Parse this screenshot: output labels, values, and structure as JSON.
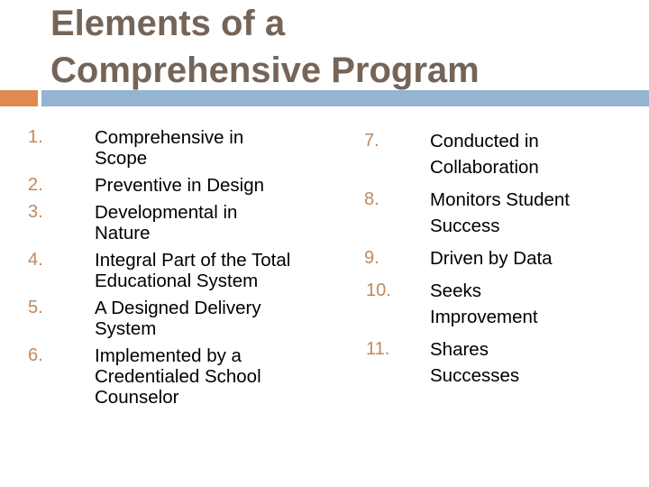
{
  "slide": {
    "title_lines": [
      "Elements of a",
      "Comprehensive Program"
    ],
    "colors": {
      "title": "#756458",
      "accent_orange": "#df8a4f",
      "accent_blue": "#94b4d1",
      "number": "#c0895d",
      "body_text": "#000000"
    }
  },
  "left_list": [
    {
      "number": "1.",
      "lines": [
        "Comprehensive in",
        "Scope"
      ]
    },
    {
      "number": "2.",
      "lines": [
        "Preventive in Design"
      ]
    },
    {
      "number": "3.",
      "lines": [
        "Developmental in",
        "Nature"
      ]
    },
    {
      "number": "4.",
      "lines": [
        "Integral Part of the Total",
        "Educational System"
      ]
    },
    {
      "number": "5.",
      "lines": [
        "A Designed Delivery",
        "System"
      ]
    },
    {
      "number": "6.",
      "lines": [
        "Implemented by a",
        "Credentialed School",
        "Counselor"
      ]
    }
  ],
  "right_list": [
    {
      "number": "7.",
      "lines": [
        "Conducted in",
        "Collaboration"
      ]
    },
    {
      "number": "8.",
      "lines": [
        "Monitors Student",
        "Success"
      ]
    },
    {
      "number": "9.",
      "lines": [
        "Driven by Data"
      ]
    },
    {
      "number": "10.",
      "lines": [
        "Seeks",
        "Improvement"
      ]
    },
    {
      "number": "11.",
      "lines": [
        "Shares",
        "Successes"
      ]
    }
  ]
}
